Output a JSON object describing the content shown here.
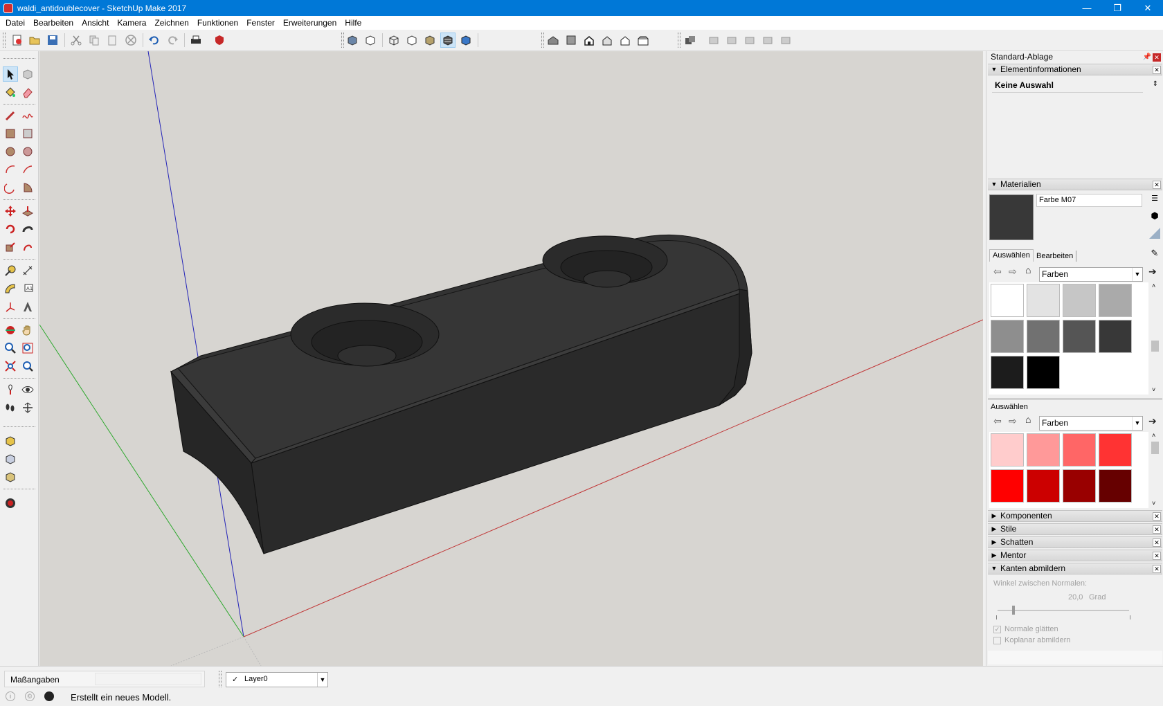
{
  "window": {
    "title": "waldi_antidoublecover - SketchUp Make 2017",
    "min": "—",
    "restore": "❐",
    "close": "✕"
  },
  "menu": [
    "Datei",
    "Bearbeiten",
    "Ansicht",
    "Kamera",
    "Zeichnen",
    "Funktionen",
    "Fenster",
    "Erweiterungen",
    "Hilfe"
  ],
  "tray": {
    "title": "Standard-Ablage",
    "entity_info": {
      "label": "Elementinformationen",
      "value": "Keine Auswahl"
    },
    "materials": {
      "label": "Materialien",
      "current_name": "Farbe M07",
      "current_color": "#383838",
      "tabs": [
        "Auswählen",
        "Bearbeiten"
      ],
      "collection": "Farben",
      "grays": [
        "#ffffff",
        "#e3e3e3",
        "#c6c6c6",
        "#aaaaaa",
        "#8e8e8e",
        "#717171",
        "#555555",
        "#383838",
        "#1c1c1c",
        "#000000"
      ],
      "second_label": "Auswählen",
      "second_collection": "Farben",
      "reds": [
        "#ffcccc",
        "#ff9999",
        "#ff6666",
        "#ff3333",
        "#ff0000",
        "#cc0000",
        "#990000",
        "#660000"
      ]
    },
    "sections": [
      "Komponenten",
      "Stile",
      "Schatten",
      "Mentor"
    ],
    "soften": {
      "label": "Kanten abmildern",
      "angle_label": "Winkel zwischen Normalen:",
      "angle_value": "20,0",
      "angle_unit": "Grad",
      "smooth_normals": "Normale glätten",
      "soften_coplanar": "Koplanar abmildern"
    }
  },
  "status": {
    "measurements_label": "Maßangaben",
    "layer": "Layer0",
    "message": "Erstellt ein neues Modell."
  }
}
